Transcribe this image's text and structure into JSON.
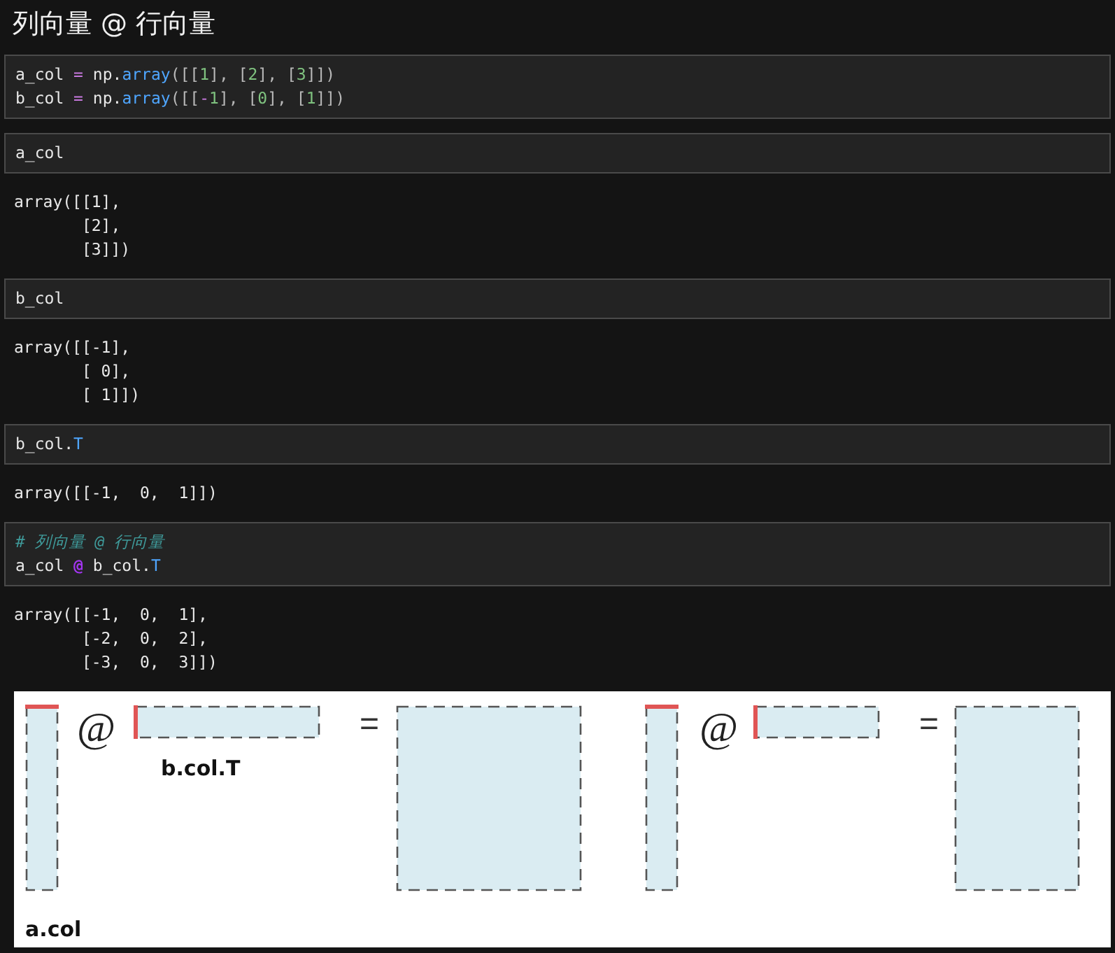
{
  "heading": "列向量 @ 行向量",
  "cells": [
    {
      "kind": "code",
      "lines": [
        [
          {
            "t": "a_col ",
            "kind": "var"
          },
          {
            "t": "=",
            "kind": "op"
          },
          {
            "t": " np.",
            "kind": "var"
          },
          {
            "t": "array",
            "kind": "fn"
          },
          {
            "t": "([[",
            "kind": "br"
          },
          {
            "t": "1",
            "kind": "num"
          },
          {
            "t": "], [",
            "kind": "br"
          },
          {
            "t": "2",
            "kind": "num"
          },
          {
            "t": "], [",
            "kind": "br"
          },
          {
            "t": "3",
            "kind": "num"
          },
          {
            "t": "]])",
            "kind": "br"
          }
        ],
        [
          {
            "t": "b_col ",
            "kind": "var"
          },
          {
            "t": "=",
            "kind": "op"
          },
          {
            "t": " np.",
            "kind": "var"
          },
          {
            "t": "array",
            "kind": "fn"
          },
          {
            "t": "([[",
            "kind": "br"
          },
          {
            "t": "-",
            "kind": "op"
          },
          {
            "t": "1",
            "kind": "num"
          },
          {
            "t": "], [",
            "kind": "br"
          },
          {
            "t": "0",
            "kind": "num"
          },
          {
            "t": "], [",
            "kind": "br"
          },
          {
            "t": "1",
            "kind": "num"
          },
          {
            "t": "]])",
            "kind": "br"
          }
        ]
      ]
    },
    {
      "kind": "code",
      "lines": [
        [
          {
            "t": "a_col",
            "kind": "var"
          }
        ]
      ]
    },
    {
      "kind": "output",
      "lines": [
        "array([[1],",
        "       [2],",
        "       [3]])"
      ]
    },
    {
      "kind": "code",
      "lines": [
        [
          {
            "t": "b_col",
            "kind": "var"
          }
        ]
      ]
    },
    {
      "kind": "output",
      "lines": [
        "array([[-1],",
        "       [ 0],",
        "       [ 1]])"
      ]
    },
    {
      "kind": "code",
      "lines": [
        [
          {
            "t": "b_col.",
            "kind": "var"
          },
          {
            "t": "T",
            "kind": "fn"
          }
        ]
      ]
    },
    {
      "kind": "output",
      "lines": [
        "array([[-1,  0,  1]])"
      ]
    },
    {
      "kind": "code",
      "lines": [
        [
          {
            "t": "# 列向量 @ 行向量",
            "kind": "comment"
          }
        ],
        [
          {
            "t": "a_col ",
            "kind": "var"
          },
          {
            "t": "@",
            "kind": "matmul"
          },
          {
            "t": " b_col.",
            "kind": "var"
          },
          {
            "t": "T",
            "kind": "fn"
          }
        ]
      ]
    },
    {
      "kind": "output",
      "lines": [
        "array([[-1,  0,  1],",
        "       [-2,  0,  2],",
        "       [-3,  0,  3]])"
      ]
    }
  ],
  "diagram": {
    "panels": [
      {
        "at": "@",
        "eq": "=",
        "row_label": "b.col.T"
      },
      {
        "at": "@",
        "eq": "="
      }
    ],
    "col_label": "a.col"
  }
}
